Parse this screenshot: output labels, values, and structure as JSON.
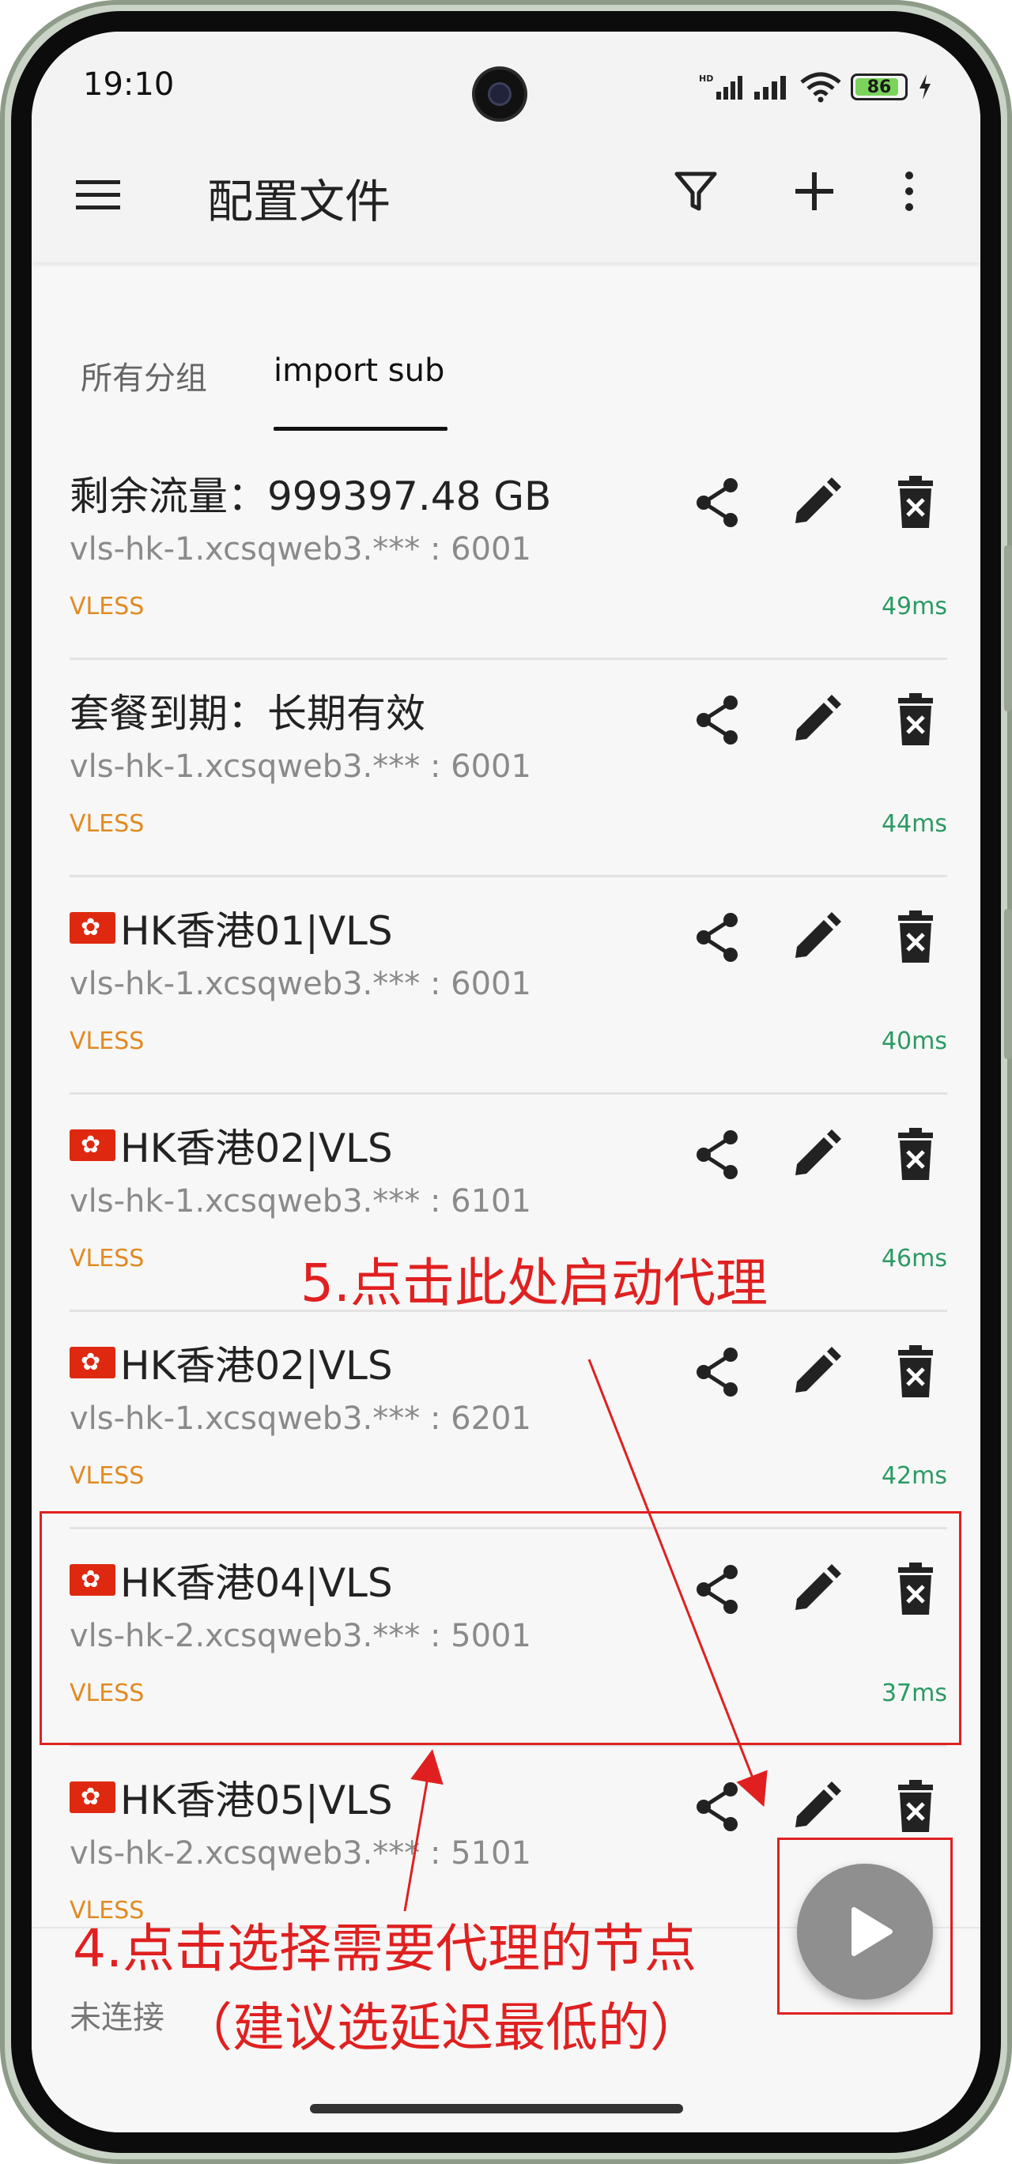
{
  "status_bar": {
    "time": "19:10",
    "battery": "86",
    "icons": [
      "hd-signal-icon",
      "signal-icon",
      "wifi-icon",
      "battery-icon",
      "charging-icon"
    ]
  },
  "app_bar": {
    "title": "配置文件",
    "icons": [
      "menu-icon",
      "filter-icon",
      "add-icon",
      "more-vert-icon"
    ]
  },
  "tabs": [
    {
      "label": "所有分组"
    },
    {
      "label": "import sub",
      "selected": true
    }
  ],
  "servers": [
    {
      "title": "剩余流量：999397.48 GB",
      "flag": false,
      "address": "vls-hk-1.xcsqweb3.*** : 6001",
      "protocol": "VLESS",
      "latency": "49ms"
    },
    {
      "title": "套餐到期：长期有效",
      "flag": false,
      "address": "vls-hk-1.xcsqweb3.*** : 6001",
      "protocol": "VLESS",
      "latency": "44ms"
    },
    {
      "title": "HK香港01|VLS",
      "flag": true,
      "address": "vls-hk-1.xcsqweb3.*** : 6001",
      "protocol": "VLESS",
      "latency": "40ms"
    },
    {
      "title": "HK香港02|VLS",
      "flag": true,
      "address": "vls-hk-1.xcsqweb3.*** : 6101",
      "protocol": "VLESS",
      "latency": "46ms"
    },
    {
      "title": "HK香港02|VLS",
      "flag": true,
      "address": "vls-hk-1.xcsqweb3.*** : 6201",
      "protocol": "VLESS",
      "latency": "42ms"
    },
    {
      "title": "HK香港04|VLS",
      "flag": true,
      "address": "vls-hk-2.xcsqweb3.*** : 5001",
      "protocol": "VLESS",
      "latency": "37ms"
    },
    {
      "title": "HK香港05|VLS",
      "flag": true,
      "address": "vls-hk-2.xcsqweb3.*** : 5101",
      "protocol": "VLESS",
      "latency": ""
    }
  ],
  "row_actions": [
    "share-icon",
    "edit-icon",
    "delete-icon"
  ],
  "bottom_bar": {
    "connection_status": "未连接"
  },
  "fab": {
    "icon": "play-icon"
  },
  "annotations": {
    "step5": "5.点击此处启动代理",
    "step4": "4.点击选择需要代理的节点",
    "step4_note": "（建议选延迟最低的）"
  },
  "colors": {
    "protocol": "#e08a22",
    "latency": "#2b9a63",
    "annotation": "#e02020",
    "fab": "#8f8f8f"
  }
}
